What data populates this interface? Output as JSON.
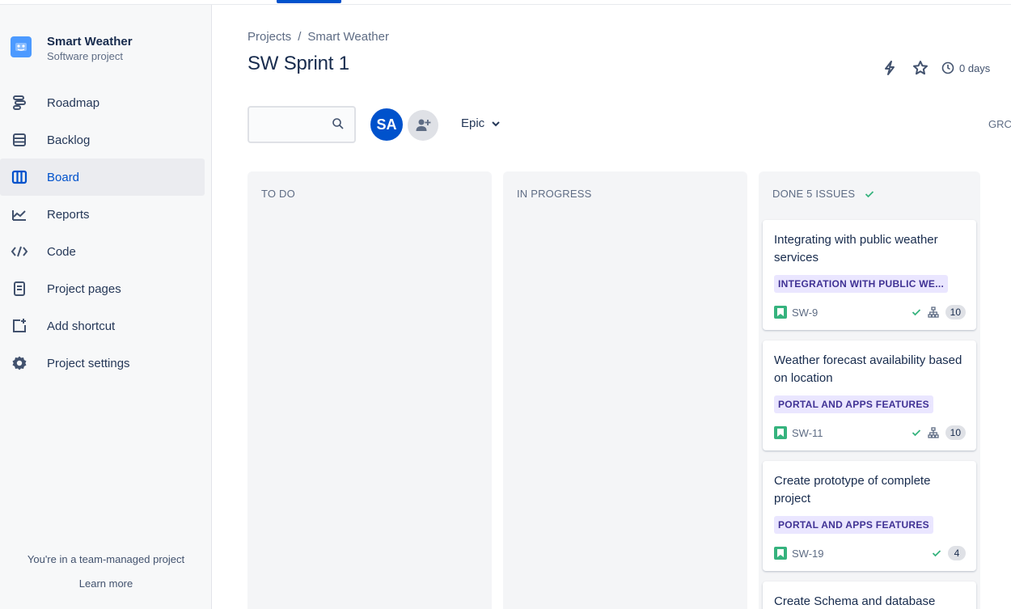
{
  "project": {
    "name": "Smart Weather",
    "type": "Software project"
  },
  "sidebar": {
    "items": [
      {
        "label": "Roadmap",
        "icon": "roadmap-icon"
      },
      {
        "label": "Backlog",
        "icon": "backlog-icon"
      },
      {
        "label": "Board",
        "icon": "board-icon",
        "active": true
      },
      {
        "label": "Reports",
        "icon": "reports-icon"
      },
      {
        "label": "Code",
        "icon": "code-icon"
      },
      {
        "label": "Project pages",
        "icon": "project-pages-icon"
      },
      {
        "label": "Add shortcut",
        "icon": "add-shortcut-icon"
      },
      {
        "label": "Project settings",
        "icon": "settings-gear-icon"
      }
    ],
    "team_note": "You're in a team-managed project",
    "learn_more": "Learn more"
  },
  "header": {
    "breadcrumb": [
      "Projects",
      "Smart Weather"
    ],
    "breadcrumb_sep": "/",
    "title": "SW Sprint 1",
    "days_remaining": "0 days"
  },
  "toolbar": {
    "search_placeholder": "",
    "avatar_initials": "SA",
    "epic_label": "Epic",
    "group_by_label": "GRC"
  },
  "columns": [
    {
      "title": "TO DO"
    },
    {
      "title": "IN PROGRESS"
    },
    {
      "title": "DONE 5 ISSUES"
    }
  ],
  "cards": [
    {
      "title": "Integrating with public weather services",
      "epic": "INTEGRATION WITH PUBLIC WE...",
      "key": "SW-9",
      "has_subtasks": true,
      "points": "10"
    },
    {
      "title": "Weather forecast availability based on location",
      "epic": "PORTAL AND APPS FEATURES",
      "key": "SW-11",
      "has_subtasks": true,
      "points": "10"
    },
    {
      "title": "Create prototype of complete project",
      "epic": "PORTAL AND APPS FEATURES",
      "key": "SW-19",
      "has_subtasks": false,
      "points": "4"
    },
    {
      "title": "Create Schema and database",
      "epic": "",
      "key": "",
      "has_subtasks": false,
      "points": ""
    }
  ],
  "colors": {
    "brand_blue": "#0052cc",
    "epic_bg": "#eae6ff",
    "epic_text": "#403294",
    "story_green": "#36b37e",
    "done_check": "#36b37e"
  }
}
